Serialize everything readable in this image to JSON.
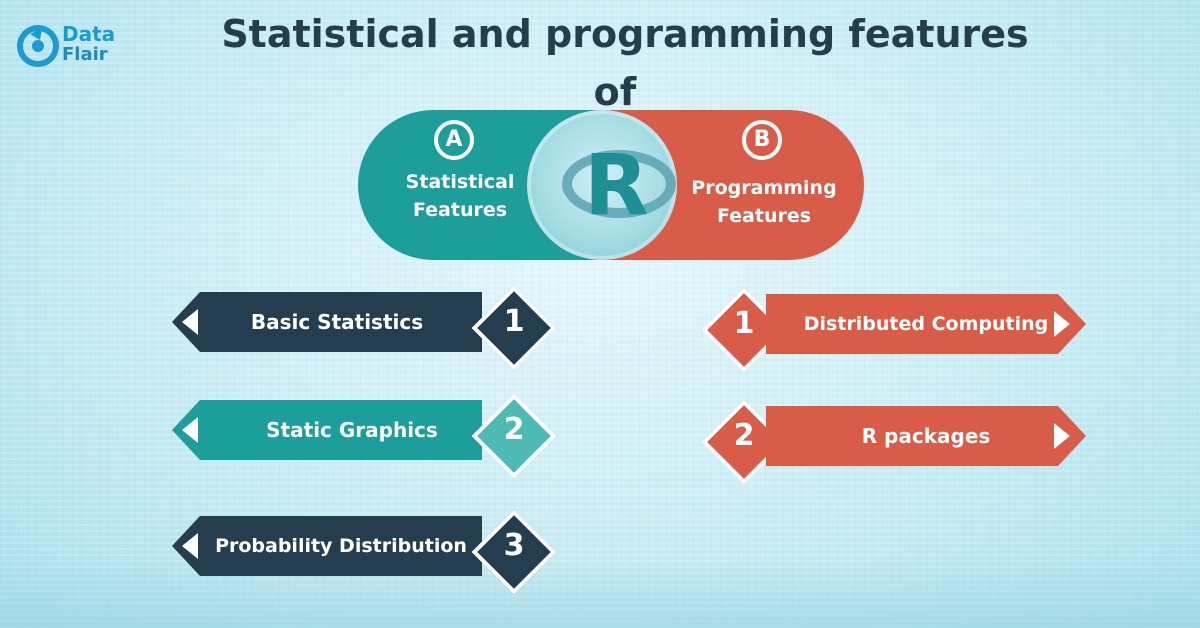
{
  "logo": {
    "line1": "Data",
    "line2": "Flair"
  },
  "title": {
    "line1": "Statistical and programming features",
    "line2": "of"
  },
  "center": {
    "letter": "R",
    "left": {
      "badge": "A",
      "label": "Statistical Features"
    },
    "right": {
      "badge": "B",
      "label": "Programming Features"
    }
  },
  "statistical_features": [
    {
      "number": "1",
      "label": "Basic Statistics"
    },
    {
      "number": "2",
      "label": "Static Graphics"
    },
    {
      "number": "3",
      "label": "Probability Distribution"
    }
  ],
  "programming_features": [
    {
      "number": "1",
      "label": "Distributed Computing"
    },
    {
      "number": "2",
      "label": "R packages"
    }
  ],
  "colors": {
    "dark_navy": "#243e4f",
    "teal": "#1c9e9a",
    "light_teal": "#4cbab5",
    "orange": "#d85c48",
    "title": "#263d4c",
    "logo_blue": "#1a9bd1"
  }
}
